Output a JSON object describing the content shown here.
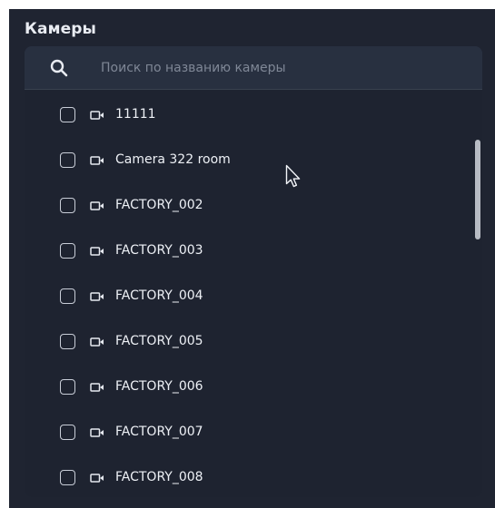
{
  "panel": {
    "title": "Камеры"
  },
  "search": {
    "icon": "search-icon",
    "placeholder": "Поиск по названию камеры",
    "value": ""
  },
  "cameras": [
    {
      "label": "11111",
      "checked": false,
      "icon": "camera-icon"
    },
    {
      "label": "Camera 322 room",
      "checked": false,
      "icon": "camera-icon"
    },
    {
      "label": "FACTORY_002",
      "checked": false,
      "icon": "camera-icon"
    },
    {
      "label": "FACTORY_003",
      "checked": false,
      "icon": "camera-icon"
    },
    {
      "label": "FACTORY_004",
      "checked": false,
      "icon": "camera-icon"
    },
    {
      "label": "FACTORY_005",
      "checked": false,
      "icon": "camera-icon"
    },
    {
      "label": "FACTORY_006",
      "checked": false,
      "icon": "camera-icon"
    },
    {
      "label": "FACTORY_007",
      "checked": false,
      "icon": "camera-icon"
    },
    {
      "label": "FACTORY_008",
      "checked": false,
      "icon": "camera-icon"
    }
  ],
  "colors": {
    "panel_bg": "#1f2431",
    "search_bg": "#283040",
    "list_bg": "#1e2330",
    "text": "#eef1f6",
    "placeholder": "#7f8796",
    "scrollbar": "#b7bbc3"
  }
}
